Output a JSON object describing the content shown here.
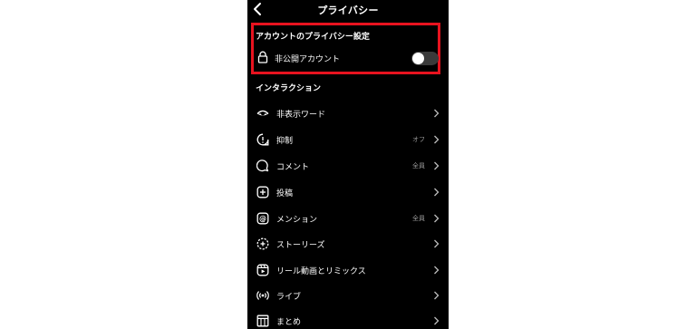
{
  "header": {
    "title": "プライバシー"
  },
  "account_privacy": {
    "section_title": "アカウントのプライバシー設定",
    "private_account_label": "非公開アカウント",
    "private_account_toggle": "off",
    "highlight_color": "#e8131f"
  },
  "interactions": {
    "section_title": "インタラクション",
    "items": [
      {
        "label": "非表示ワード",
        "value": "",
        "icon": "eye-icon"
      },
      {
        "label": "抑制",
        "value": "オフ",
        "icon": "restrict-icon"
      },
      {
        "label": "コメント",
        "value": "全員",
        "icon": "comment-icon"
      },
      {
        "label": "投稿",
        "value": "",
        "icon": "plus-square-icon"
      },
      {
        "label": "メンション",
        "value": "全員",
        "icon": "at-icon"
      },
      {
        "label": "ストーリーズ",
        "value": "",
        "icon": "story-icon"
      },
      {
        "label": "リール動画とリミックス",
        "value": "",
        "icon": "reels-icon"
      },
      {
        "label": "ライブ",
        "value": "",
        "icon": "live-icon"
      },
      {
        "label": "まとめ",
        "value": "",
        "icon": "guides-icon"
      }
    ]
  }
}
